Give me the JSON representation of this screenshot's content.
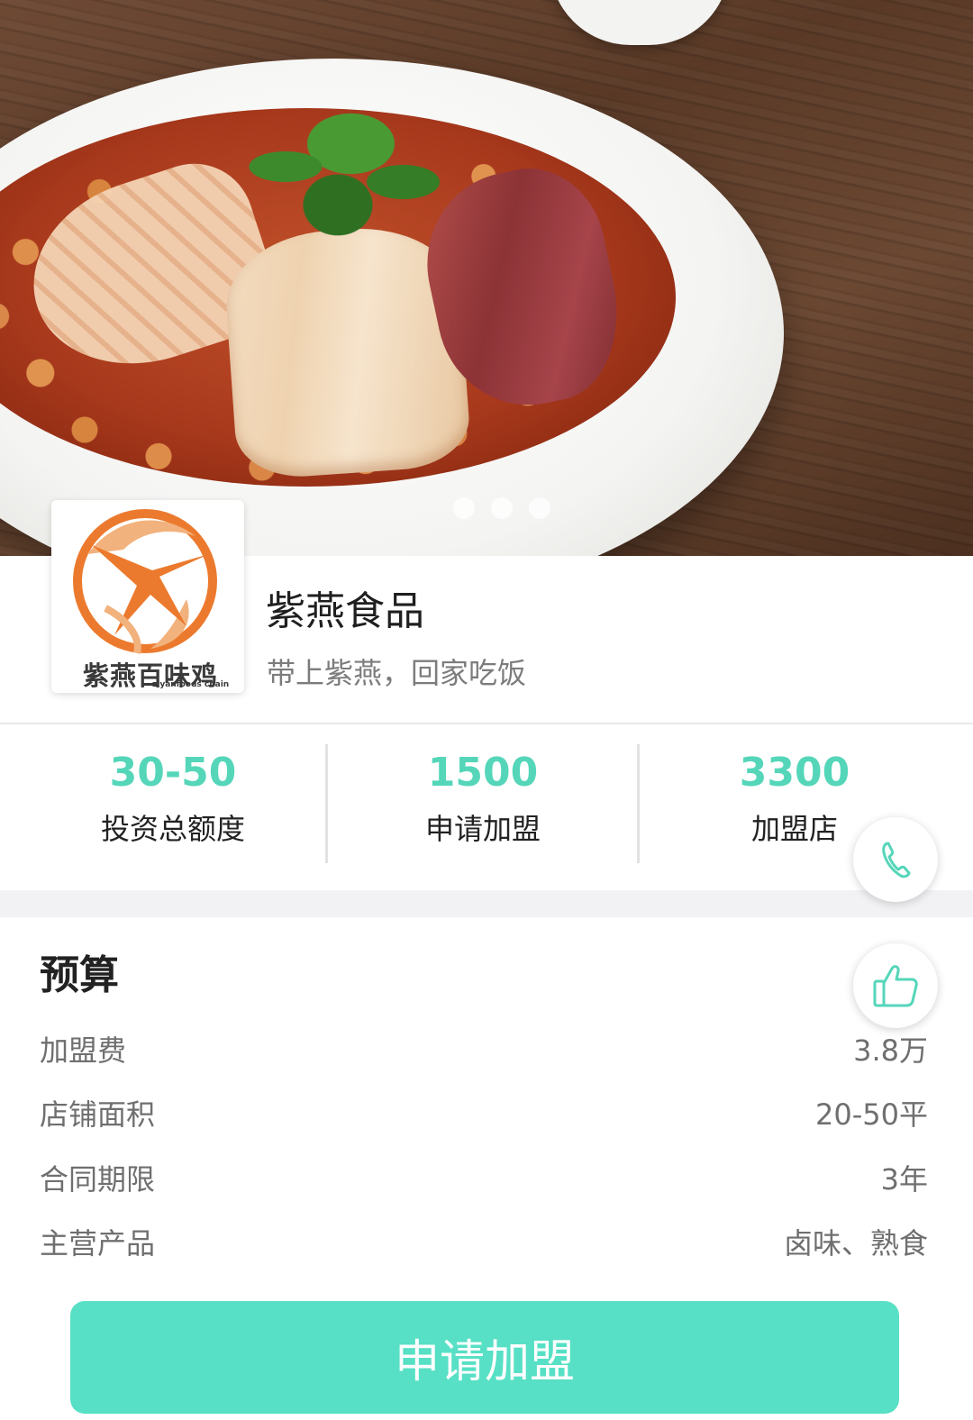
{
  "banner": {
    "carousel_dots": 3,
    "active_dot": 1
  },
  "brand": {
    "name": "紫燕食品",
    "slogan": "带上紫燕，回家吃饭",
    "logo_text": "紫燕百味鸡",
    "logo_subtext": "ziyanfoods chain",
    "logo_color": "#ec7a2e"
  },
  "stats": [
    {
      "value": "30-50",
      "label": "投资总额度"
    },
    {
      "value": "1500",
      "label": "申请加盟"
    },
    {
      "value": "3300",
      "label": "加盟店"
    }
  ],
  "budget": {
    "title": "预算",
    "rows": [
      {
        "label": "加盟费",
        "value": "3.8万"
      },
      {
        "label": "店铺面积",
        "value": "20-50平"
      },
      {
        "label": "合同期限",
        "value": "3年"
      },
      {
        "label": "主营产品",
        "value": "卤味、熟食"
      }
    ]
  },
  "actions": {
    "apply_label": "申请加盟",
    "phone_icon": "phone-icon",
    "like_icon": "thumbs-up-icon"
  },
  "colors": {
    "accent": "#55d6b9",
    "button": "#57e0c5"
  }
}
